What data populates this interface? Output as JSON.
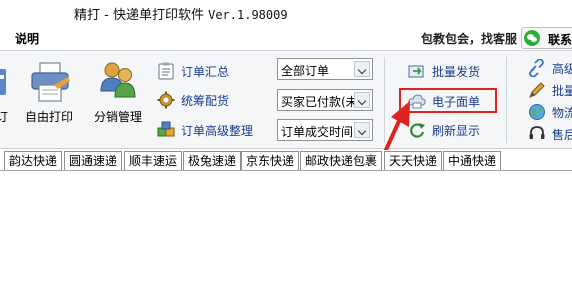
{
  "window": {
    "title": "精打 - 快递单打印软件 ",
    "version": "Ver.1.98009"
  },
  "menubar": {
    "help": "说明",
    "promo": "包教包会，找客服",
    "contact": "联系"
  },
  "ribbon": {
    "partial_left": "订",
    "big_buttons": [
      {
        "label": "自由打印",
        "icon": "printer-icon"
      },
      {
        "label": "分销管理",
        "icon": "users-icon"
      }
    ],
    "group1": [
      {
        "label": "订单汇总",
        "icon": "clipboard-icon"
      },
      {
        "label": "统筹配货",
        "icon": "gear-icon"
      },
      {
        "label": "订单高级整理",
        "icon": "cubes-icon"
      }
    ],
    "combos": [
      {
        "value": "全部订单"
      },
      {
        "value": "买家已付款(未"
      },
      {
        "value": "订单成交时间,"
      }
    ],
    "group2": [
      {
        "label": "批量发货",
        "icon": "ship-icon"
      },
      {
        "label": "电子面单",
        "icon": "cloud-icon"
      },
      {
        "label": "刷新显示",
        "icon": "refresh-icon"
      }
    ],
    "group3": [
      {
        "label": "高级",
        "icon": "link-icon"
      },
      {
        "label": "批量",
        "icon": "pencil-icon"
      },
      {
        "label": "物流",
        "icon": "globe-icon"
      },
      {
        "label": "售后",
        "icon": "headset-icon"
      }
    ]
  },
  "colors": {
    "accent_link": "#1a3d8f",
    "highlight": "#e22121"
  },
  "tabs": [
    {
      "label": "韵达快递"
    },
    {
      "label": "圆通速递"
    },
    {
      "label": "顺丰速运"
    },
    {
      "label": "极兔速递"
    },
    {
      "label": "京东快递"
    },
    {
      "label": "邮政快递包裹"
    },
    {
      "label": "天天快递"
    },
    {
      "label": "中通快递"
    }
  ]
}
